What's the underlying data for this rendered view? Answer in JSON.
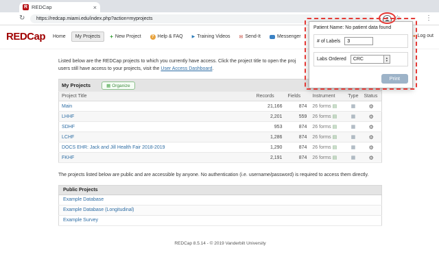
{
  "browser": {
    "tab": {
      "title": "REDCap",
      "favicon_letter": "R"
    },
    "url": "https://redcap.miami.edu/index.php?action=myprojects"
  },
  "icons": {
    "refresh": "↻",
    "star": "☆",
    "menu_dots": "⋮",
    "tab_close": "×",
    "new_project_plus": "+",
    "help_question": "?",
    "video_play": "▶",
    "sendit_envelope": "✉",
    "logout_arrow": "↪",
    "organize_grid": "▦",
    "instrument_list": "▤",
    "type_sheet": "▦",
    "status_wrench": "⚙",
    "stepper_up": "▲",
    "stepper_down": "▼"
  },
  "extension_popup": {
    "patient_line": "Patient Name: No patient data found",
    "labels_field": {
      "label": "# of Labels",
      "value": "3"
    },
    "labs_field": {
      "label": "Labs Ordered",
      "value": "CRC"
    },
    "print_button": "Print"
  },
  "nav": {
    "logo": "REDCap",
    "items": [
      {
        "label": "Home"
      },
      {
        "label": "My Projects"
      },
      {
        "label": "New Project"
      },
      {
        "label": "Help & FAQ"
      },
      {
        "label": "Training Videos"
      },
      {
        "label": "Send-It"
      },
      {
        "label": "Messenger"
      }
    ],
    "logout_label": "Log out"
  },
  "content": {
    "intro_line1": "Listed below are the REDCap projects to which you currently have access. Click the project title to open the proj",
    "intro_line2_prefix": "users still have access to your projects, visit the ",
    "intro_link": "User Access Dashboard",
    "intro_line2_suffix": ".",
    "my_projects": {
      "title": "My Projects",
      "organize_button": "Organize",
      "columns": [
        "Project Title",
        "Records",
        "Fields",
        "Instrument",
        "Type",
        "Status"
      ],
      "rows": [
        {
          "title": "Main",
          "records": "21,166",
          "fields": "874",
          "instrument": "26 forms"
        },
        {
          "title": "LHHF",
          "records": "2,201",
          "fields": "559",
          "instrument": "26 forms"
        },
        {
          "title": "SDHF",
          "records": "953",
          "fields": "874",
          "instrument": "26 forms"
        },
        {
          "title": "LCHF",
          "records": "1,286",
          "fields": "874",
          "instrument": "26 forms"
        },
        {
          "title": "DOCS EHR: Jack and Jill Health Fair 2018-2019",
          "records": "1,290",
          "fields": "874",
          "instrument": "26 forms"
        },
        {
          "title": "FKHF",
          "records": "2,191",
          "fields": "874",
          "instrument": "26 forms"
        }
      ]
    },
    "public_intro": "The projects listed below are public and are accessible by anyone. No authentication (i.e. username/password) is required to access them directly.",
    "public_projects": {
      "title": "Public Projects",
      "rows": [
        {
          "title": "Example Database"
        },
        {
          "title": "Example Database (Longitudinal)"
        },
        {
          "title": "Example Survey"
        }
      ]
    },
    "footer": "REDCap 8.5.14 - © 2019 Vanderbilt University"
  },
  "colors": {
    "brand_red": "#a00000",
    "link_blue": "#2e6da4",
    "annotation_red": "#e53935",
    "print_button": "#9db3c8",
    "organize_green": "#3c8a3c"
  }
}
